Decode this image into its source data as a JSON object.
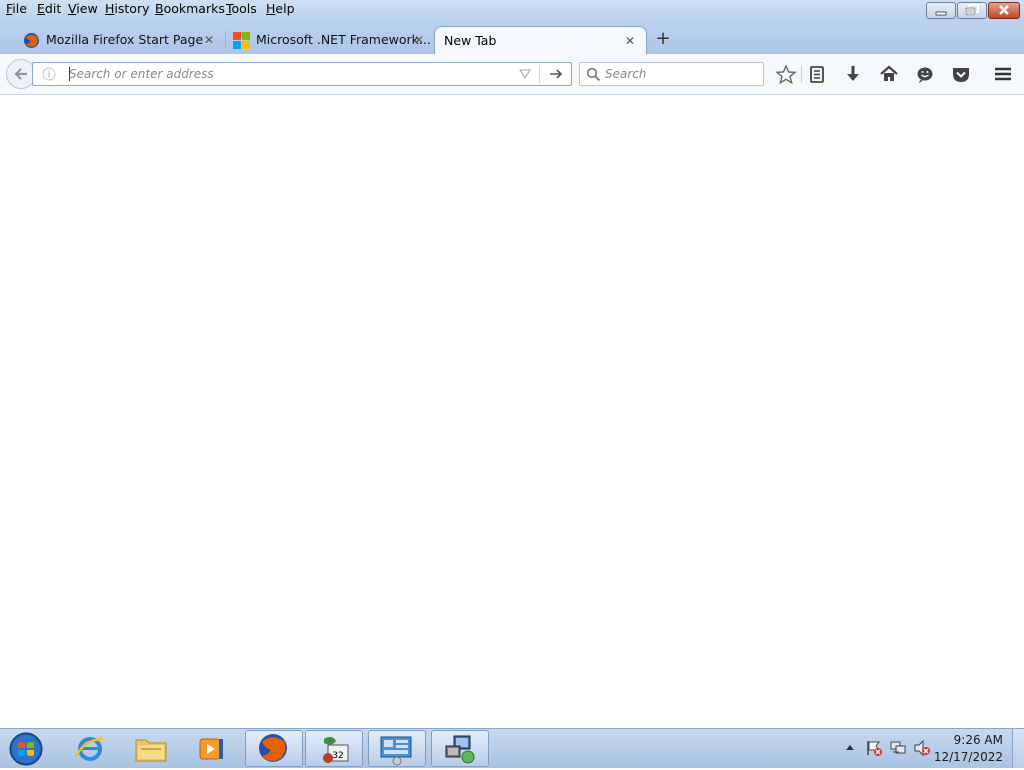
{
  "menu": {
    "items": [
      {
        "label": "File",
        "accel": "F",
        "rest": "ile"
      },
      {
        "label": "Edit",
        "accel": "E",
        "rest": "dit"
      },
      {
        "label": "View",
        "accel": "V",
        "rest": "iew"
      },
      {
        "label": "History",
        "accel": "H",
        "rest": "istory"
      },
      {
        "label": "Bookmarks",
        "accel": "B",
        "rest": "ookmarks"
      },
      {
        "label": "Tools",
        "accel": "T",
        "rest": "ools"
      },
      {
        "label": "Help",
        "accel": "H",
        "rest": "elp"
      }
    ]
  },
  "tabs": [
    {
      "title": "Mozilla Firefox Start Page",
      "icon": "firefox-icon",
      "active": false
    },
    {
      "title": "Microsoft .NET Framework...",
      "icon": "microsoft-logo-icon",
      "active": false
    },
    {
      "title": "New Tab",
      "icon": "",
      "active": true
    }
  ],
  "navbar": {
    "url_placeholder": "Search or enter address",
    "search_placeholder": "Search"
  },
  "taskbar": {
    "apps": [
      "start-orb-icon",
      "internet-explorer-icon",
      "file-explorer-icon",
      "media-player-icon",
      "firefox-icon",
      "installer-32-icon",
      "control-panel-icon",
      "network-setup-icon"
    ],
    "clock_time": "9:26 AM",
    "clock_date": "12/17/2022"
  },
  "colors": {
    "accent": "#bcd3ee",
    "close_button": "#c4452a",
    "active_tab": "#f5f8fc"
  }
}
